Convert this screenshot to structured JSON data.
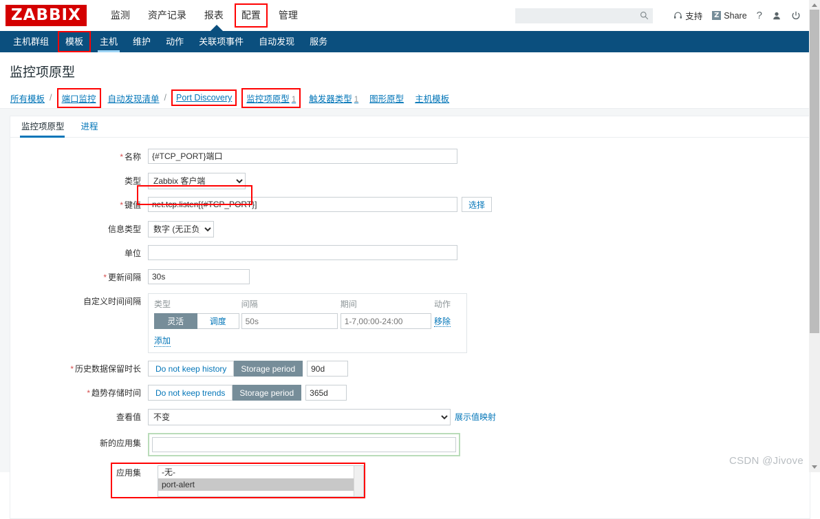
{
  "header": {
    "logo": "ZABBIX",
    "nav": [
      {
        "label": "监测",
        "highlight": false
      },
      {
        "label": "资产记录",
        "highlight": false
      },
      {
        "label": "报表",
        "highlight": false
      },
      {
        "label": "配置",
        "highlight": true
      },
      {
        "label": "管理",
        "highlight": false
      }
    ],
    "search_placeholder": "",
    "search_value": "",
    "search_icon": "search-icon",
    "support_label": "支持",
    "support_icon": "headset-icon",
    "share_label": "Share",
    "share_icon": "zabbix-z-icon",
    "help_label": "?",
    "user_icon": "user-icon",
    "signout_icon": "power-icon"
  },
  "subnav": {
    "items": [
      {
        "label": "主机群组",
        "active": false,
        "highlight": false
      },
      {
        "label": "模板",
        "active": false,
        "highlight": true
      },
      {
        "label": "主机",
        "active": true,
        "highlight": false
      },
      {
        "label": "维护",
        "active": false,
        "highlight": false
      },
      {
        "label": "动作",
        "active": false,
        "highlight": false
      },
      {
        "label": "关联项事件",
        "active": false,
        "highlight": false
      },
      {
        "label": "自动发现",
        "active": false,
        "highlight": false
      },
      {
        "label": "服务",
        "active": false,
        "highlight": false
      }
    ]
  },
  "page": {
    "title": "监控项原型"
  },
  "breadcrumb": {
    "separator": "/",
    "items": [
      {
        "label": "所有模板",
        "count": "",
        "highlight": false,
        "link": true
      },
      {
        "label": "端口监控",
        "count": "",
        "highlight": true,
        "link": true
      },
      {
        "label": "自动发现清单",
        "count": "",
        "highlight": false,
        "link": true
      },
      {
        "label": "Port Discovery",
        "count": "",
        "highlight": true,
        "link": true
      },
      {
        "label": "监控项原型",
        "count": "1",
        "highlight": true,
        "link": true
      },
      {
        "label": "触发器类型",
        "count": "1",
        "highlight": false,
        "link": true
      },
      {
        "label": "图形原型",
        "count": "",
        "highlight": false,
        "link": true
      },
      {
        "label": "主机模板",
        "count": "",
        "highlight": false,
        "link": true
      }
    ]
  },
  "form_tabs": [
    {
      "label": "监控项原型",
      "active": true
    },
    {
      "label": "进程",
      "active": false
    }
  ],
  "form": {
    "name": {
      "label": "名称",
      "required": true,
      "value": "{#TCP_PORT}端口",
      "highlight": true
    },
    "type": {
      "label": "类型",
      "required": false,
      "value": "Zabbix 客户端",
      "options": [
        "Zabbix 客户端"
      ]
    },
    "key": {
      "label": "键值",
      "required": true,
      "value": "net.tcp.listen[{#TCP_PORT}]",
      "highlight": true,
      "select_button": "选择"
    },
    "info_type": {
      "label": "信息类型",
      "required": false,
      "value": "数字 (无正负)",
      "options": [
        "数字 (无正负)"
      ]
    },
    "unit": {
      "label": "单位",
      "required": false,
      "value": ""
    },
    "update_interval": {
      "label": "更新间隔",
      "required": true,
      "value": "30s"
    },
    "custom_intervals": {
      "label": "自定义时间间隔",
      "columns": [
        "类型",
        "间隔",
        "期间",
        "动作"
      ],
      "rows": [
        {
          "type_flexible": "灵活",
          "type_scheduling": "调度",
          "type_selected": "灵活",
          "interval_placeholder": "50s",
          "interval_value": "",
          "period_placeholder": "1-7,00:00-24:00",
          "period_value": "",
          "action": "移除"
        }
      ],
      "add_label": "添加"
    },
    "history": {
      "label": "历史数据保留时长",
      "required": true,
      "option_off": "Do not keep history",
      "option_on": "Storage period",
      "selected": "Storage period",
      "value": "90d"
    },
    "trends": {
      "label": "趋势存储时间",
      "required": true,
      "option_off": "Do not keep trends",
      "option_on": "Storage period",
      "selected": "Storage period",
      "value": "365d"
    },
    "show_value": {
      "label": "查看值",
      "required": false,
      "value": "不变",
      "options": [
        "不变"
      ],
      "link_label": "展示值映射"
    },
    "new_application": {
      "label": "新的应用集",
      "required": false,
      "value": "",
      "focused": true
    },
    "applications": {
      "label": "应用集",
      "required": false,
      "highlight": true,
      "options": [
        {
          "label": "-无-",
          "selected": false
        },
        {
          "label": "port-alert",
          "selected": true
        }
      ]
    }
  },
  "watermark": "CSDN @Jivove"
}
